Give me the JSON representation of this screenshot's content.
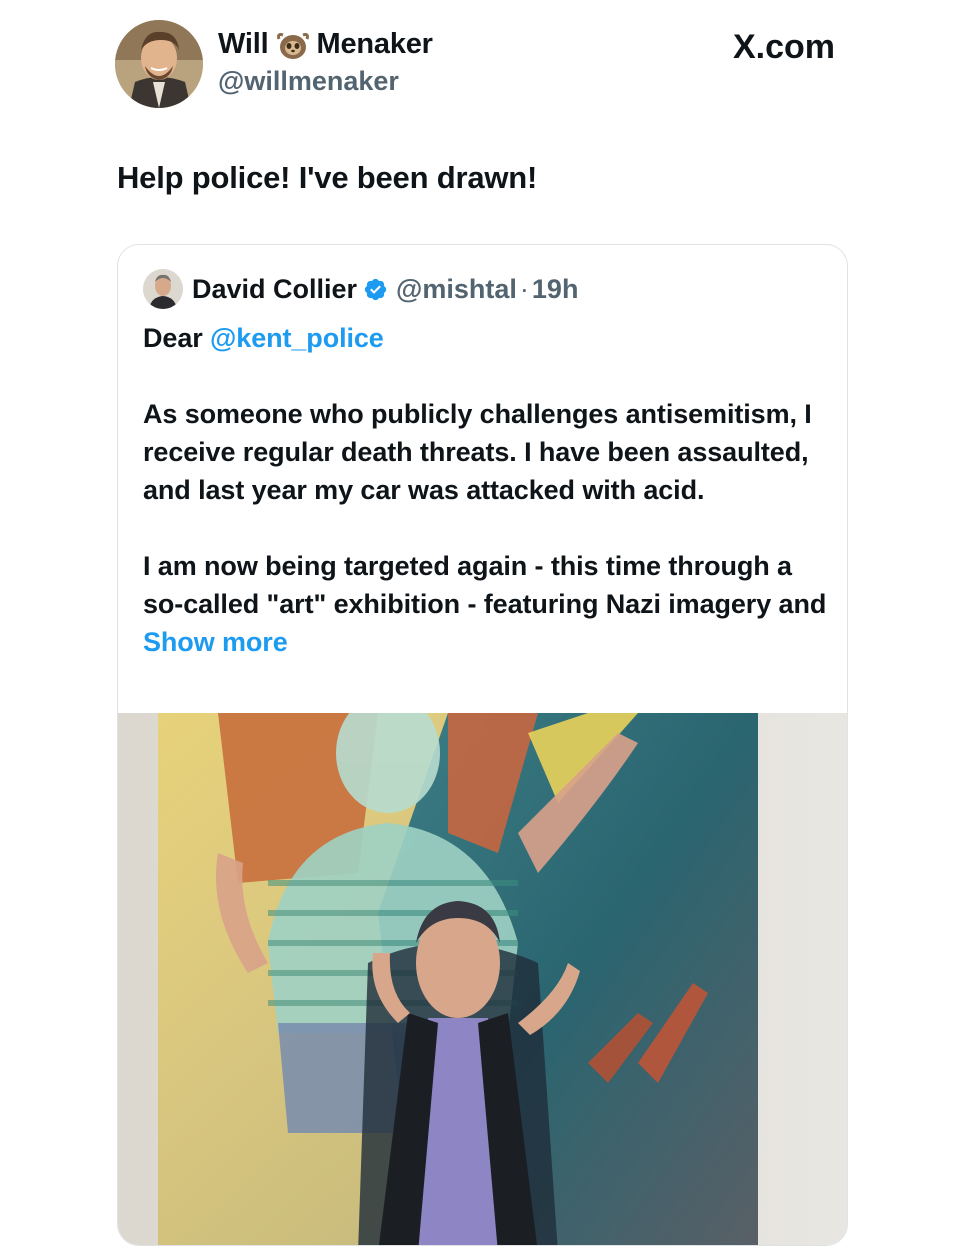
{
  "author": {
    "first_name": "Will",
    "name_emoji": "sloth-emoji",
    "last_name": "Menaker",
    "handle": "@willmenaker"
  },
  "watermark": "X.com",
  "tweet": {
    "text": "Help police! I've been drawn!"
  },
  "quoted_tweet": {
    "name": "David Collier",
    "verified": true,
    "handle": "@mishtal",
    "separator": "·",
    "time": "19h",
    "greeting": "Dear",
    "mention": "@kent_police",
    "paragraph1": "As someone who publicly challenges antisemitism, I receive regular death threats. I have been assaulted, and last year my car was attacked with acid.",
    "paragraph2": "I am now being targeted again - this time through a so-called \"art\" exhibition - featuring Nazi imagery and",
    "show_more": "Show more"
  },
  "colors": {
    "link": "#1d9bf0",
    "secondary_text": "#536471",
    "verified_badge": "#1d9bf0"
  }
}
